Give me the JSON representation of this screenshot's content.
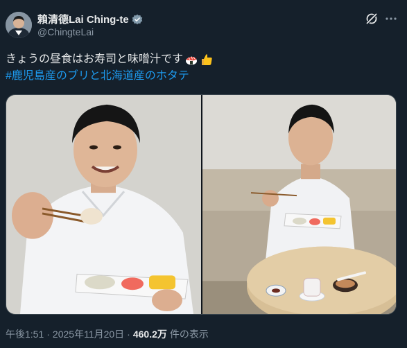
{
  "author": {
    "display_name": "賴清德Lai Ching-te",
    "handle": "@ChingteLai",
    "verified": true
  },
  "post": {
    "text": "きょうの昼食はお寿司と味噌汁です",
    "emojis": [
      "sushi-emoji",
      "thumbs-up-emoji"
    ],
    "hashtag": "#鹿児島産のブリと北海道産のホタテ"
  },
  "media": {
    "photos": [
      {
        "name": "photo-left",
        "description_icon": "photo"
      },
      {
        "name": "photo-right",
        "description_icon": "photo"
      }
    ]
  },
  "meta": {
    "time": "午後1:51",
    "separator": "·",
    "date": "2025年11月20日",
    "separator2": "·",
    "views": "460.2万",
    "views_label": "件の表示"
  },
  "colors": {
    "background": "#15202b",
    "link": "#1d9bf0",
    "secondary_text": "#8b98a5",
    "verified_badge": "#829aab"
  },
  "icons": {
    "grok": "grok-icon",
    "more": "more-icon",
    "verified": "verified-badge-icon"
  }
}
